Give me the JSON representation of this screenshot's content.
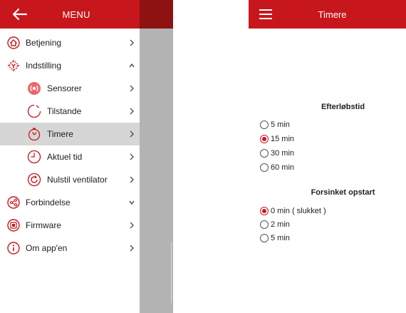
{
  "drawer": {
    "title": "MENU",
    "items": [
      {
        "label": "Betjening"
      },
      {
        "label": "Indstilling"
      },
      {
        "label": "Sensorer"
      },
      {
        "label": "Tilstande"
      },
      {
        "label": "Timere"
      },
      {
        "label": "Aktuel tid"
      },
      {
        "label": "Nulstil ventilator"
      },
      {
        "label": "Forbindelse"
      },
      {
        "label": "Firmware"
      },
      {
        "label": "Om app'en"
      }
    ]
  },
  "timere": {
    "title": "Timere",
    "sections": [
      {
        "title": "Efterløbstid",
        "options": [
          {
            "label": "5 min",
            "checked": false
          },
          {
            "label": "15 min",
            "checked": true
          },
          {
            "label": "30 min",
            "checked": false
          },
          {
            "label": "60 min",
            "checked": false
          }
        ]
      },
      {
        "title": "Forsinket opstart",
        "options": [
          {
            "label": "0 min ( slukket )",
            "checked": true
          },
          {
            "label": "2 min",
            "checked": false
          },
          {
            "label": "5 min",
            "checked": false
          }
        ]
      }
    ]
  },
  "colors": {
    "accent": "#c8161d",
    "backdrop": "#b3b3b3",
    "active_row": "#d6d6d6"
  }
}
